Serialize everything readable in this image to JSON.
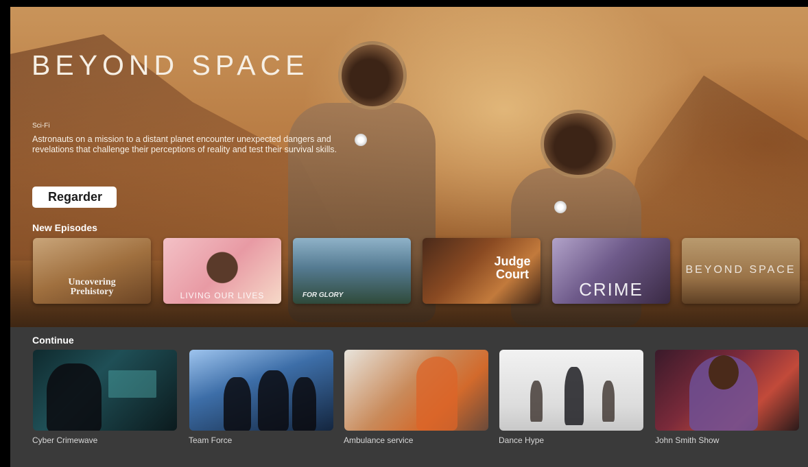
{
  "hero": {
    "title": "BEYOND SPACE",
    "genre": "Sci-Fi",
    "description": "Astronauts on a mission to a distant planet encounter unexpected dangers and revelations that challenge their perceptions of reality and test their survival skills.",
    "watch_label": "Regarder"
  },
  "new_episodes": {
    "label": "New Episodes",
    "items": [
      {
        "title": "Uncovering Prehistory",
        "art_text": "Uncovering Prehistory"
      },
      {
        "title": "Living Our Lives",
        "art_text": "LIVING OUR LIVES"
      },
      {
        "title": "For Glory",
        "art_text": "FOR GLORY"
      },
      {
        "title": "Judge Court",
        "art_text": "Judge Court"
      },
      {
        "title": "Crime",
        "art_text": "CRIME"
      },
      {
        "title": "Beyond Space",
        "art_text": "BEYOND SPACE"
      }
    ]
  },
  "continue": {
    "label": "Continue",
    "items": [
      {
        "title": "Cyber Crimewave"
      },
      {
        "title": "Team Force"
      },
      {
        "title": "Ambulance service"
      },
      {
        "title": "Dance Hype"
      },
      {
        "title": "John Smith Show"
      }
    ]
  },
  "colors": {
    "bottom_band": "#3a3a3a",
    "button_bg": "#ffffff",
    "hero_text": "#f6efe4"
  }
}
